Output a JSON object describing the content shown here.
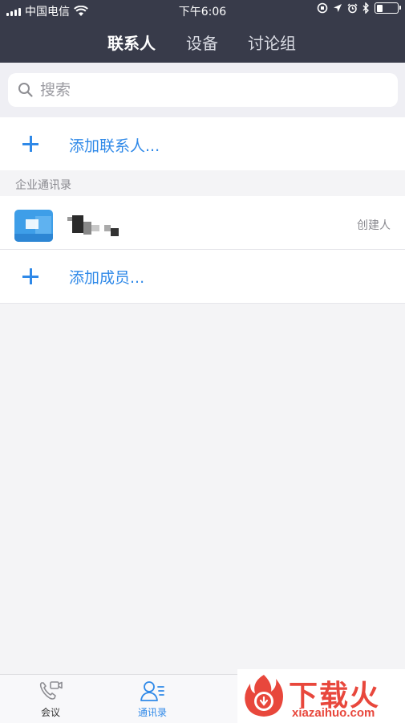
{
  "status_bar": {
    "carrier": "中国电信",
    "time": "下午6:06"
  },
  "header": {
    "tabs": [
      {
        "label": "联系人",
        "active": true
      },
      {
        "label": "设备",
        "active": false
      },
      {
        "label": "讨论组",
        "active": false
      }
    ]
  },
  "search": {
    "placeholder": "搜索"
  },
  "actions": {
    "add_contact": "添加联系人..."
  },
  "enterprise_directory": {
    "section_title": "企业通讯录",
    "members": [
      {
        "role_badge": "创建人"
      }
    ],
    "add_member": "添加成员..."
  },
  "tab_bar": {
    "items": [
      {
        "label": "会议",
        "active": false,
        "icon": "phone-video-icon"
      },
      {
        "label": "通讯录",
        "active": true,
        "icon": "contacts-icon"
      }
    ]
  },
  "watermark": {
    "title": "下载火",
    "url": "xiazaihuo.com"
  },
  "colors": {
    "header_bg": "#383b4a",
    "accent": "#2f89e8",
    "watermark": "#e8473c"
  }
}
